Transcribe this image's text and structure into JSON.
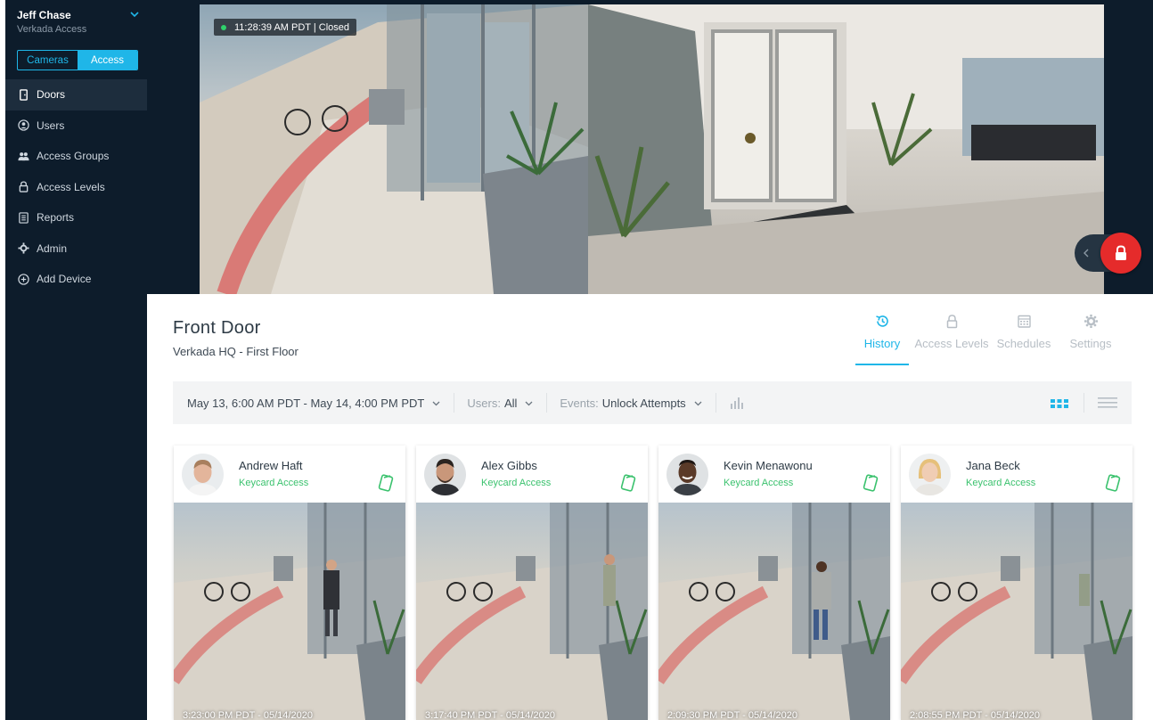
{
  "account": {
    "name": "Jeff Chase",
    "org": "Verkada Access"
  },
  "mode_toggle": {
    "cameras": "Cameras",
    "access": "Access"
  },
  "nav": {
    "doors": "Doors",
    "users": "Users",
    "access_groups": "Access Groups",
    "access_levels": "Access Levels",
    "reports": "Reports",
    "admin": "Admin",
    "add_device": "Add Device"
  },
  "camera": {
    "timestamp": "11:28:39 AM PDT | Closed"
  },
  "door": {
    "title": "Front Door",
    "location": "Verkada HQ - First Floor"
  },
  "tabs": {
    "history": "History",
    "access_levels": "Access Levels",
    "schedules": "Schedules",
    "settings": "Settings"
  },
  "filters": {
    "date_range": "May 13, 6:00 AM PDT - May 14, 4:00 PM PDT",
    "users_label": "Users:",
    "users_value": "All",
    "events_label": "Events:",
    "events_value": "Unlock Attempts"
  },
  "events": [
    {
      "name": "Andrew Haft",
      "method": "Keycard Access",
      "time": "3:23:00 PM PDT - 05/14/2020"
    },
    {
      "name": "Alex Gibbs",
      "method": "Keycard Access",
      "time": "3:17:40 PM PDT - 05/14/2020"
    },
    {
      "name": "Kevin Menawonu",
      "method": "Keycard Access",
      "time": "2:09:30 PM PDT - 05/14/2020"
    },
    {
      "name": "Jana Beck",
      "method": "Keycard Access",
      "time": "2:08:55 PM PDT - 05/14/2020"
    }
  ],
  "colors": {
    "sidebar_bg": "#0d1c2b",
    "accent": "#1fb6e8",
    "success": "#3bc26e",
    "lock_red": "#e52b2b"
  },
  "icons": {
    "doors": "door-icon",
    "users": "user-circle-icon",
    "access_groups": "group-icon",
    "access_levels": "lock-icon",
    "reports": "report-icon",
    "admin": "gear-icon",
    "add_device": "plus-circle-icon"
  }
}
